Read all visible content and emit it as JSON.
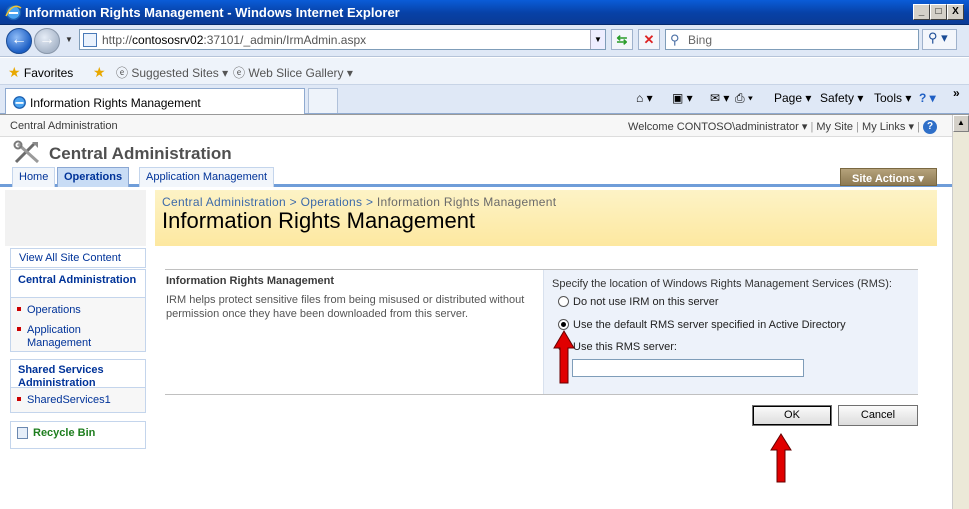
{
  "window": {
    "title": "Information Rights Management - Windows Internet Explorer",
    "controls": {
      "minimize": "_",
      "maximize": "□",
      "close": "X"
    }
  },
  "browser": {
    "url_prefix": "http://",
    "url_host": "contososrv02",
    "url_rest": ":37101/_admin/IrmAdmin.aspx",
    "search_placeholder": "Bing",
    "favorites_label": "Favorites",
    "suggested_sites": "Suggested Sites",
    "web_slice_gallery": "Web Slice Gallery",
    "tab_title": "Information Rights Management",
    "command_bar": {
      "page": "Page",
      "safety": "Safety",
      "tools": "Tools"
    },
    "overflow": "»"
  },
  "sharepoint": {
    "top_link": "Central Administration",
    "welcome": "Welcome CONTOSO\\administrator",
    "my_site": "My Site",
    "my_links": "My Links",
    "site_title": "Central Administration",
    "nav_tabs": [
      {
        "label": "Home"
      },
      {
        "label": "Operations"
      },
      {
        "label": "Application Management"
      }
    ],
    "site_actions": "Site Actions",
    "breadcrumb": {
      "root": "Central Administration",
      "sep": ">",
      "parent": "Operations",
      "current": "Information Rights Management"
    },
    "page_title": "Information Rights Management"
  },
  "quick_launch": {
    "view_all": "View All Site Content",
    "central_admin_heading": "Central Administration",
    "central_admin_items": [
      "Operations",
      "Application Management"
    ],
    "ssp_heading": "Shared Services Administration",
    "ssp_items": [
      "SharedServices1"
    ],
    "recycle_bin": "Recycle Bin"
  },
  "irm_section": {
    "title": "Information Rights Management",
    "description": "IRM helps protect sensitive files from being misused or distributed without permission once they have been downloaded from this server.",
    "location_label": "Specify the location of Windows Rights Management Services (RMS):",
    "options": [
      {
        "label": "Do not use IRM on this server",
        "selected": false
      },
      {
        "label": "Use the default RMS server specified in Active Directory",
        "selected": true
      },
      {
        "label": "Use this RMS server:",
        "selected": false
      }
    ],
    "rms_server_value": ""
  },
  "buttons": {
    "ok": "OK",
    "cancel": "Cancel"
  },
  "colors": {
    "title_bar": "#0741a6",
    "link_blue": "#003399",
    "title_band": "#fde8a0",
    "site_actions": "#8d7a53",
    "annotation_arrow": "#e00000"
  }
}
